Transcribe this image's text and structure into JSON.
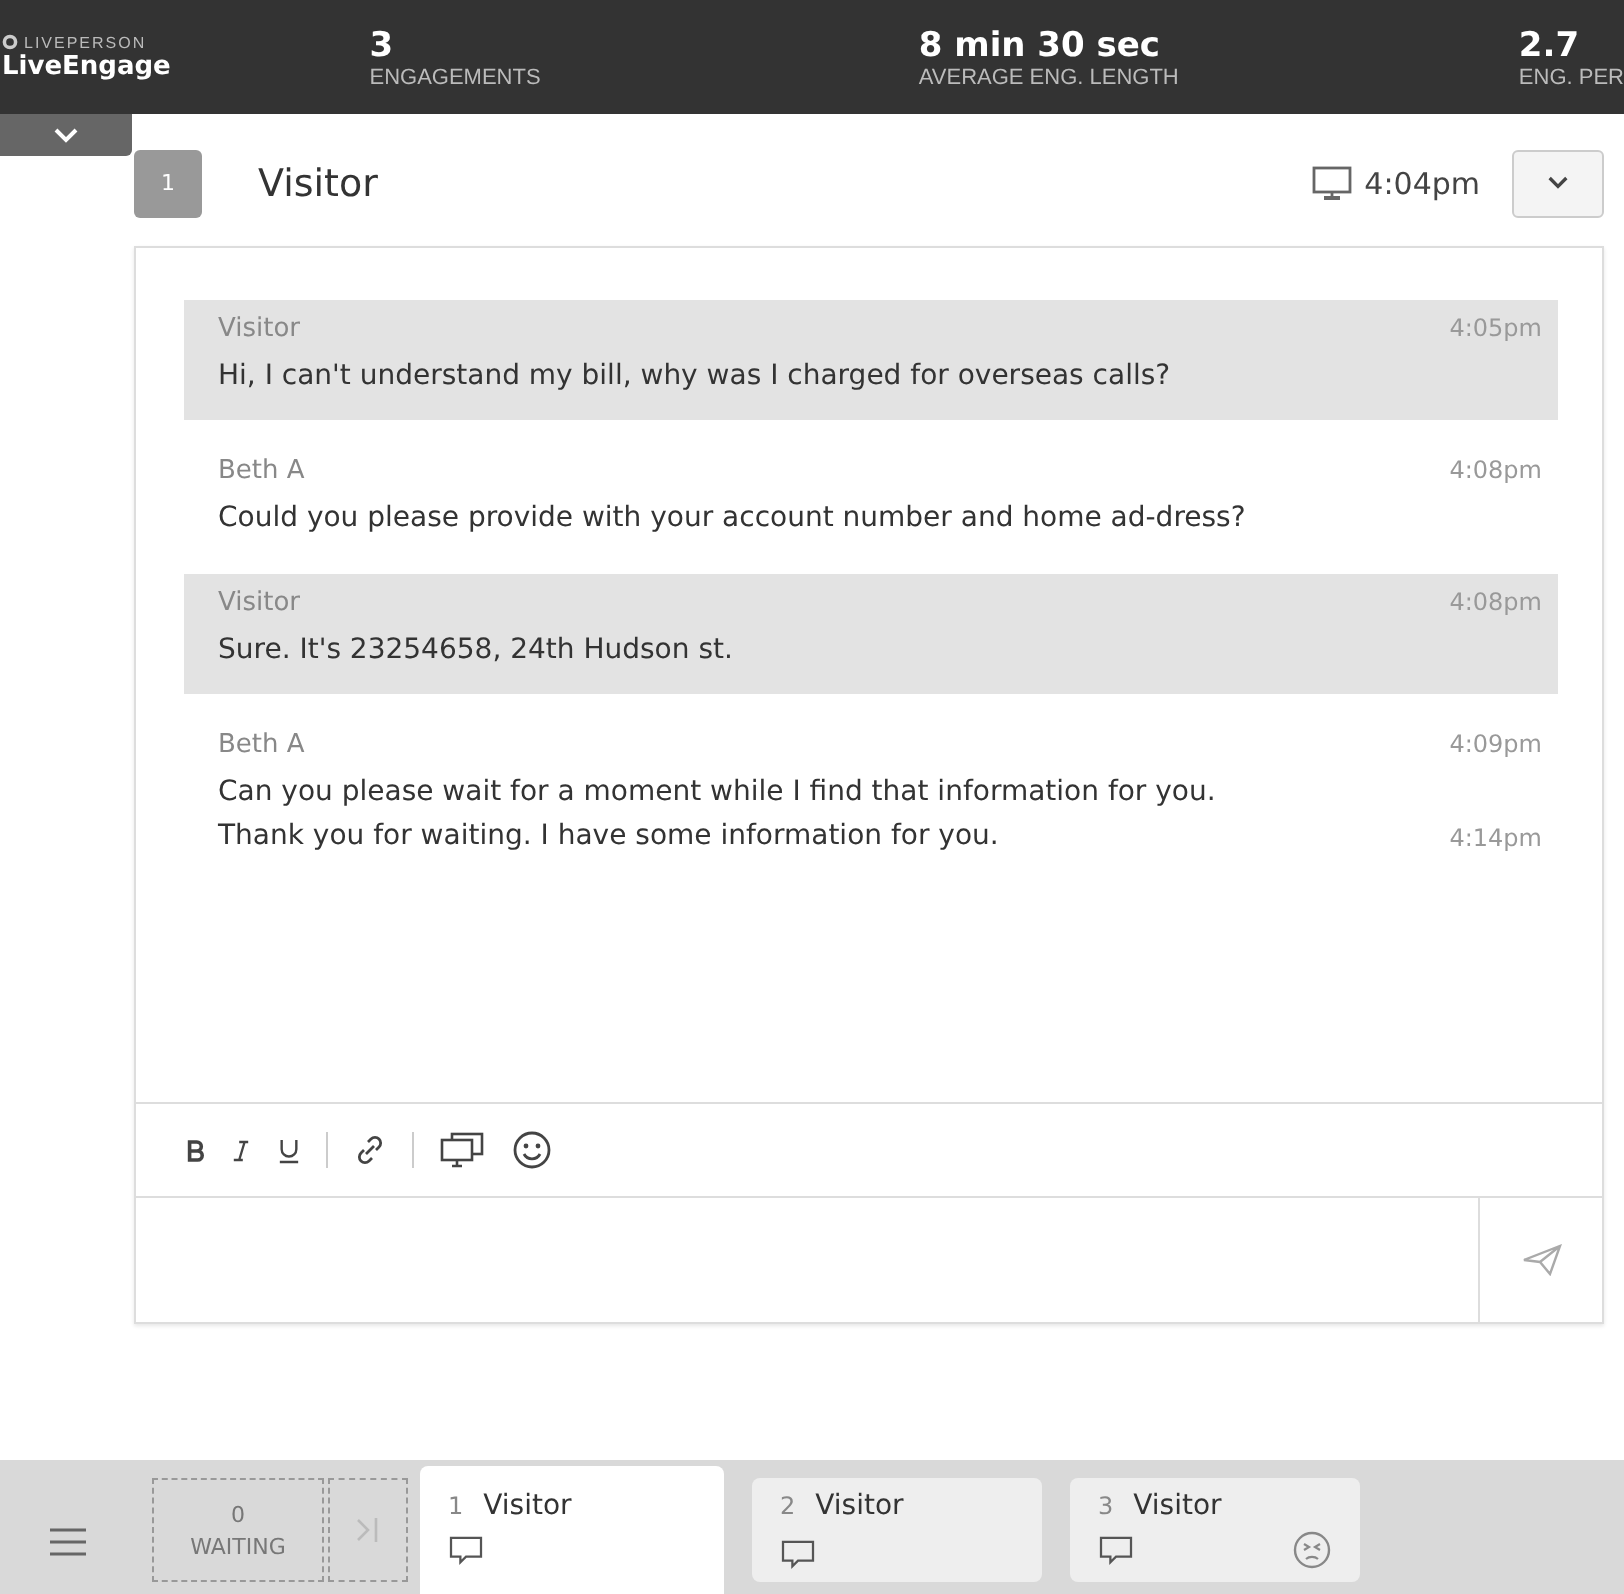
{
  "header": {
    "brand_small": "LIVEPERSON",
    "brand": "LiveEngage",
    "stats": [
      {
        "value": "3",
        "label": "ENGAGEMENTS"
      },
      {
        "value": "8 min 30 sec",
        "label": "AVERAGE ENG. LENGTH"
      },
      {
        "value": "2.7",
        "label": "ENG. PER"
      }
    ]
  },
  "conversation": {
    "number": "1",
    "title": "Visitor",
    "start_time": "4:04pm",
    "messages": [
      {
        "kind": "visitor",
        "sender": "Visitor",
        "time": "4:05pm",
        "lines": [
          {
            "text": "Hi, I can't understand my bill, why was I charged for overseas calls?"
          }
        ]
      },
      {
        "kind": "agent",
        "sender": "Beth A",
        "time": "4:08pm",
        "lines": [
          {
            "text": "Could you please provide with your account number and home ad-dress?"
          }
        ]
      },
      {
        "kind": "visitor",
        "sender": "Visitor",
        "time": "4:08pm",
        "lines": [
          {
            "text": "Sure. It's 23254658, 24th Hudson st."
          }
        ]
      },
      {
        "kind": "agent",
        "sender": "Beth A",
        "time": "4:09pm",
        "lines": [
          {
            "text": "Can you please wait for a moment while I find that information for you."
          },
          {
            "text": "Thank you for waiting. I have some information for you.",
            "time": "4:14pm"
          }
        ]
      }
    ]
  },
  "bottom_bar": {
    "waiting_count": "0",
    "waiting_label": "WAITING",
    "tabs": [
      {
        "number": "1",
        "title": "Visitor",
        "selected": true,
        "frustrated": false
      },
      {
        "number": "2",
        "title": "Visitor",
        "selected": false,
        "frustrated": false
      },
      {
        "number": "3",
        "title": "Visitor",
        "selected": false,
        "frustrated": true
      }
    ]
  }
}
